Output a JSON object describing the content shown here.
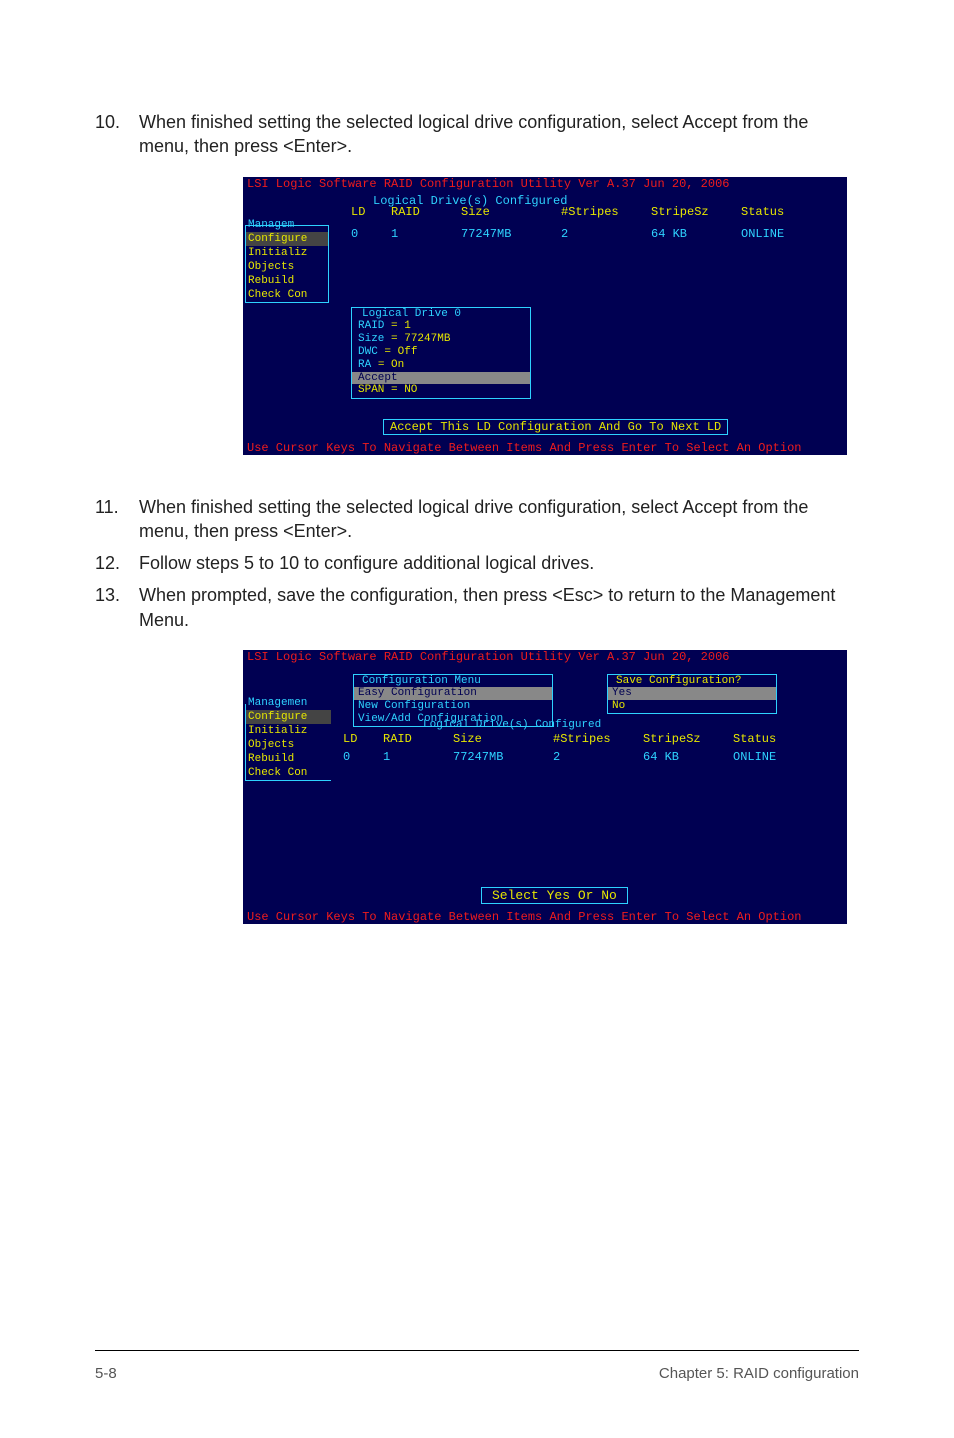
{
  "steps": {
    "s10": {
      "num": "10.",
      "text": "When finished setting the selected logical drive configuration, select Accept from the menu, then press <Enter>."
    },
    "s11": {
      "num": "11.",
      "text": "When finished setting the selected logical drive configuration, select Accept from the menu, then press <Enter>."
    },
    "s12": {
      "num": "12.",
      "text": "Follow steps 5 to 10 to configure additional logical drives."
    },
    "s13": {
      "num": "13.",
      "text": "When prompted, save the configuration, then press <Esc> to return to the Management Menu."
    }
  },
  "bios1": {
    "title": "LSI Logic Software RAID Configuration Utility Ver A.37 Jun 20, 2006",
    "pane_title": "Logical Drive(s) Configured",
    "headers": {
      "ld": "LD",
      "raid": "RAID",
      "size": "Size",
      "stripes": "#Stripes",
      "stripesz": "StripeSz",
      "status": "Status"
    },
    "row": {
      "ld": "0",
      "raid": "1",
      "size": "77247MB",
      "stripes": "2",
      "stripesz": "64  KB",
      "status": "ONLINE"
    },
    "sidemenu": {
      "title": "Managem",
      "items": [
        "Configure",
        "Initializ",
        "Objects",
        "Rebuild",
        "Check Con"
      ]
    },
    "ldbox": {
      "title": "Logical Drive 0",
      "lines": {
        "raid": {
          "k": "RAID",
          "v": "= 1"
        },
        "size": {
          "k": "Size",
          "v": "= 77247MB"
        },
        "dwc": {
          "k": "DWC",
          "v": "= Off"
        },
        "ra": {
          "k": "RA",
          "v": "= On"
        },
        "accept": "Accept",
        "span": "SPAN = NO"
      }
    },
    "accept_bar": "Accept This LD Configuration And Go To Next LD",
    "bottom": "Use Cursor Keys To Navigate Between Items And Press Enter To Select An Option"
  },
  "bios2": {
    "title": "LSI Logic Software RAID Configuration Utility Ver A.37 Jun 20, 2006",
    "confmenu": {
      "title": "Configuration Menu",
      "items": [
        "Easy Configuration",
        "New Configuration",
        "View/Add Configuration"
      ]
    },
    "savebox": {
      "title": "Save Configuration?",
      "yes": "Yes",
      "no": "No"
    },
    "sidemenu": {
      "title": "Managemen",
      "items": [
        "Configure",
        "Initializ",
        "Objects",
        "Rebuild",
        "Check Con"
      ]
    },
    "pane_title": "Logical Drive(s) Configured",
    "headers": {
      "ld": "LD",
      "raid": "RAID",
      "size": "Size",
      "stripes": "#Stripes",
      "stripesz": "StripeSz",
      "status": "Status"
    },
    "row": {
      "ld": "0",
      "raid": "1",
      "size": "77247MB",
      "stripes": "2",
      "stripesz": "64  KB",
      "status": "ONLINE"
    },
    "select_bar": "Select Yes Or No",
    "bottom": "Use Cursor Keys To Navigate Between Items And Press Enter To Select An Option"
  },
  "footer": {
    "left": "5-8",
    "right": "Chapter 5: RAID configuration"
  }
}
